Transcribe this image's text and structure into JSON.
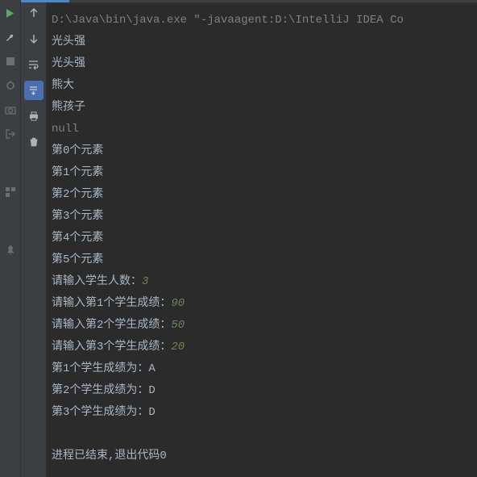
{
  "cmd": "D:\\Java\\bin\\java.exe \"-javaagent:D:\\IntelliJ IDEA Co",
  "output": {
    "names": [
      "光头强",
      "光头强",
      "熊大",
      "熊孩子"
    ],
    "null_token": "null",
    "elements": [
      "第0个元素",
      "第1个元素",
      "第2个元素",
      "第3个元素",
      "第4个元素",
      "第5个元素"
    ],
    "count_prompt": "请输入学生人数：",
    "count_value": "3",
    "score_prompts": [
      {
        "prompt": "请输入第1个学生成绩：",
        "value": "90"
      },
      {
        "prompt": "请输入第2个学生成绩：",
        "value": "50"
      },
      {
        "prompt": "请输入第3个学生成绩：",
        "value": "20"
      }
    ],
    "grades": [
      "第1个学生成绩为：A",
      "第2个学生成绩为：D",
      "第3个学生成绩为：D"
    ],
    "exit_msg": "进程已结束,退出代码0"
  },
  "toolbar": {
    "rerun": "Rerun",
    "stop": "Stop",
    "build": "Build",
    "camera": "Dump",
    "exit": "Exit",
    "layout": "Layout",
    "pin": "Pin"
  }
}
